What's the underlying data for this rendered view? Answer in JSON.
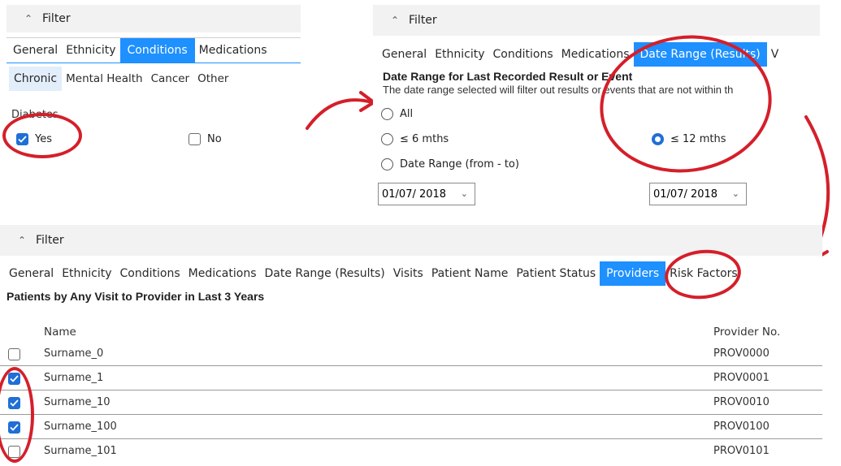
{
  "panel_a": {
    "filter_label": "Filter",
    "tabs": [
      "General",
      "Ethnicity",
      "Conditions",
      "Medications"
    ],
    "subtabs": [
      "Chronic",
      "Mental Health",
      "Cancer",
      "Other"
    ],
    "group_label": "Diabetes",
    "yes_label": "Yes",
    "no_label": "No"
  },
  "panel_b": {
    "filter_label": "Filter",
    "tabs": [
      "General",
      "Ethnicity",
      "Conditions",
      "Medications",
      "Date Range (Results)",
      "V"
    ],
    "heading": "Date Range for Last Recorded Result or Event",
    "description": "The date range selected will filter out results or events that are not within th",
    "opt_all": "All",
    "opt_6": "≤ 6 mths",
    "opt_12": "≤ 12 mths",
    "opt_range": "Date Range (from - to)",
    "date_from": "01/07/ 2018",
    "date_to": "01/07/ 2018"
  },
  "panel_c": {
    "filter_label": "Filter",
    "tabs": [
      "General",
      "Ethnicity",
      "Conditions",
      "Medications",
      "Date Range (Results)",
      "Visits",
      "Patient Name",
      "Patient Status",
      "Providers",
      "Risk Factors"
    ],
    "heading": "Patients by Any Visit to Provider in Last 3 Years",
    "col_name": "Name",
    "col_provider": "Provider No.",
    "rows": [
      {
        "name": "Surname_0",
        "provider": "PROV0000",
        "checked": false
      },
      {
        "name": "Surname_1",
        "provider": "PROV0001",
        "checked": true
      },
      {
        "name": "Surname_10",
        "provider": "PROV0010",
        "checked": true
      },
      {
        "name": "Surname_100",
        "provider": "PROV0100",
        "checked": true
      },
      {
        "name": "Surname_101",
        "provider": "PROV0101",
        "checked": false
      }
    ]
  },
  "colors": {
    "accent": "#1e90ff",
    "annotation": "#d41f2a"
  }
}
